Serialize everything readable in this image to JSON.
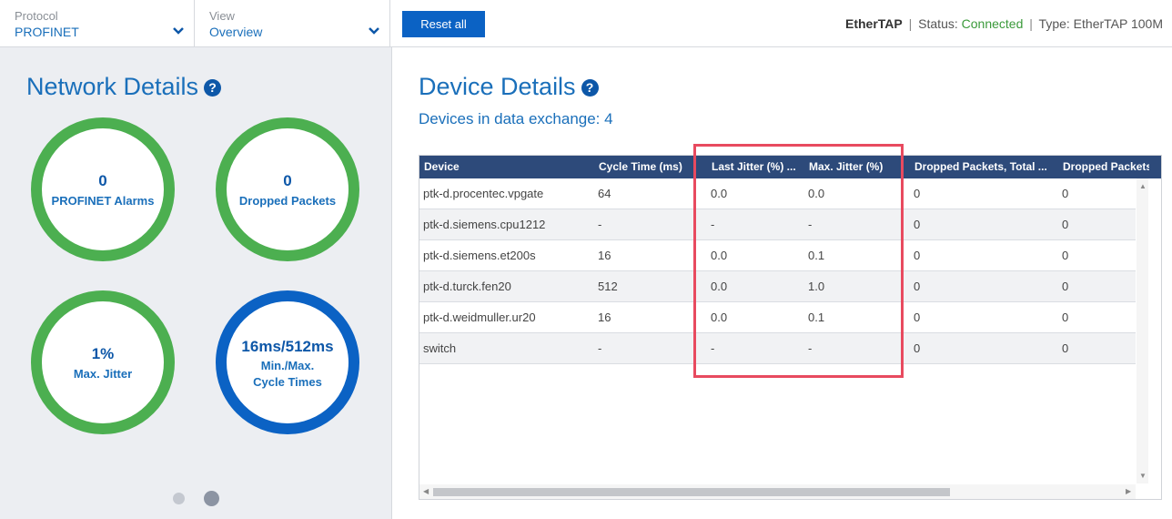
{
  "header": {
    "protocol": {
      "label": "Protocol",
      "value": "PROFINET"
    },
    "view": {
      "label": "View",
      "value": "Overview"
    },
    "reset_label": "Reset all",
    "status": {
      "device_name": "EtherTAP",
      "sep1": "|",
      "status_prefix": "Status:",
      "status_value": "Connected",
      "sep2": "|",
      "type_text": "Type: EtherTAP 100M"
    }
  },
  "network": {
    "title": "Network Details",
    "help_icon": "?",
    "alarms": {
      "value": "0",
      "label": "PROFINET Alarms"
    },
    "dropped": {
      "value": "0",
      "label": "Dropped Packets"
    },
    "jitter": {
      "value": "1%",
      "label": "Max. Jitter"
    },
    "cycle": {
      "value": "16ms/512ms",
      "label_line1": "Min./Max.",
      "label_line2": "Cycle Times"
    },
    "pager": {
      "pages": 2,
      "active": 2
    }
  },
  "device": {
    "title": "Device Details",
    "help_icon": "?",
    "subtitle": "Devices in data exchange: 4",
    "columns": [
      "Device",
      "Cycle Time (ms)",
      "Last Jitter (%) ...",
      "Max. Jitter (%)",
      "Dropped Packets, Total ...",
      "Dropped Packets"
    ],
    "rows": [
      [
        "ptk-d.procentec.vpgate",
        "64",
        "0.0",
        "0.0",
        "0",
        "0"
      ],
      [
        "ptk-d.siemens.cpu1212",
        "-",
        "-",
        "-",
        "0",
        "0"
      ],
      [
        "ptk-d.siemens.et200s",
        "16",
        "0.0",
        "0.1",
        "0",
        "0"
      ],
      [
        "ptk-d.turck.fen20",
        "512",
        "0.0",
        "1.0",
        "0",
        "0"
      ],
      [
        "ptk-d.weidmuller.ur20",
        "16",
        "0.0",
        "0.1",
        "0",
        "0"
      ],
      [
        "switch",
        "-",
        "-",
        "-",
        "0",
        "0"
      ]
    ]
  },
  "icons": {
    "chevron": "chevron-down-icon",
    "help": "help-circle-icon",
    "scroll_up": "▲",
    "scroll_down": "▼",
    "scroll_left": "◀",
    "scroll_right": "▶"
  },
  "colors": {
    "accent": "#1a6fba",
    "button": "#0b62c4",
    "ring_green": "#4caf50",
    "ring_blue": "#0b62c4",
    "table_header": "#2d4a7a",
    "status_ok": "#3a9a3a",
    "highlight": "#e84a5f"
  }
}
